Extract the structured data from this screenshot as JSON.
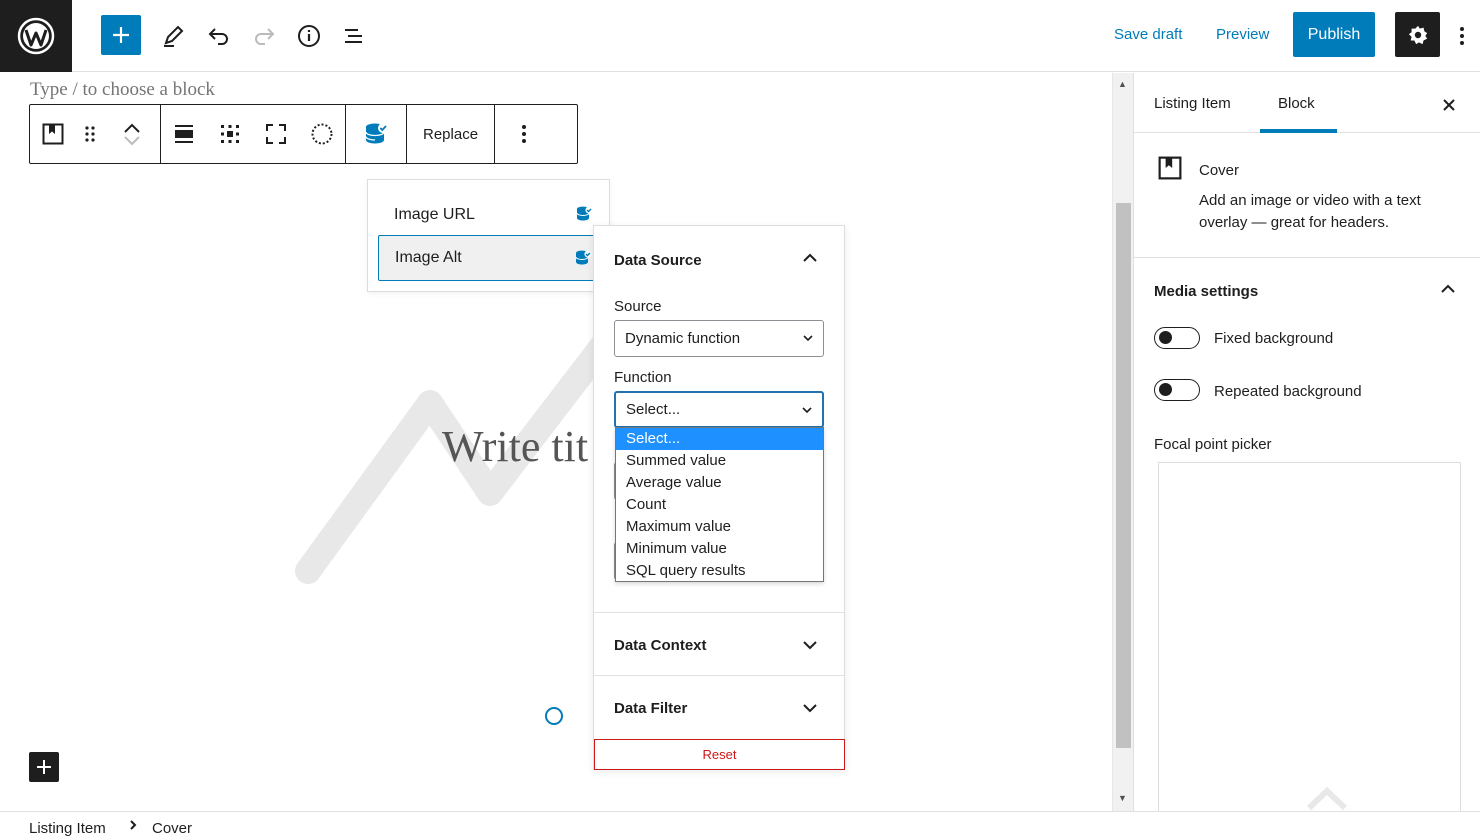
{
  "topbar": {
    "save_draft": "Save draft",
    "preview": "Preview",
    "publish": "Publish"
  },
  "canvas": {
    "placeholder": "Type / to choose a block",
    "cover_title": "Write tit"
  },
  "block_toolbar": {
    "replace_label": "Replace"
  },
  "binding_menu": {
    "items": [
      {
        "label": "Image URL",
        "active": false
      },
      {
        "label": "Image Alt",
        "active": true
      }
    ]
  },
  "data_panel": {
    "section_title": "Data Source",
    "source_label": "Source",
    "source_value": "Dynamic function",
    "function_label": "Function",
    "function_value": "Select...",
    "function_options": [
      "Select...",
      "Summed value",
      "Average value",
      "Count",
      "Maximum value",
      "Minimum value",
      "SQL query results"
    ],
    "context_title": "Data Context",
    "filter_title": "Data Filter",
    "reset_label": "Reset"
  },
  "sidebar": {
    "tabs": [
      "Listing Item",
      "Block"
    ],
    "active_tab": "Block",
    "block_name": "Cover",
    "block_description": "Add an image or video with a text overlay — great for headers.",
    "media_settings": "Media settings",
    "fixed_background": "Fixed background",
    "repeated_background": "Repeated background",
    "focal_point": "Focal point picker"
  },
  "breadcrumb": [
    "Listing Item",
    "Cover"
  ],
  "colors": {
    "accent": "#007cba",
    "dark": "#1e1e1e",
    "danger": "#cc1818",
    "highlight": "#1e90ff"
  }
}
